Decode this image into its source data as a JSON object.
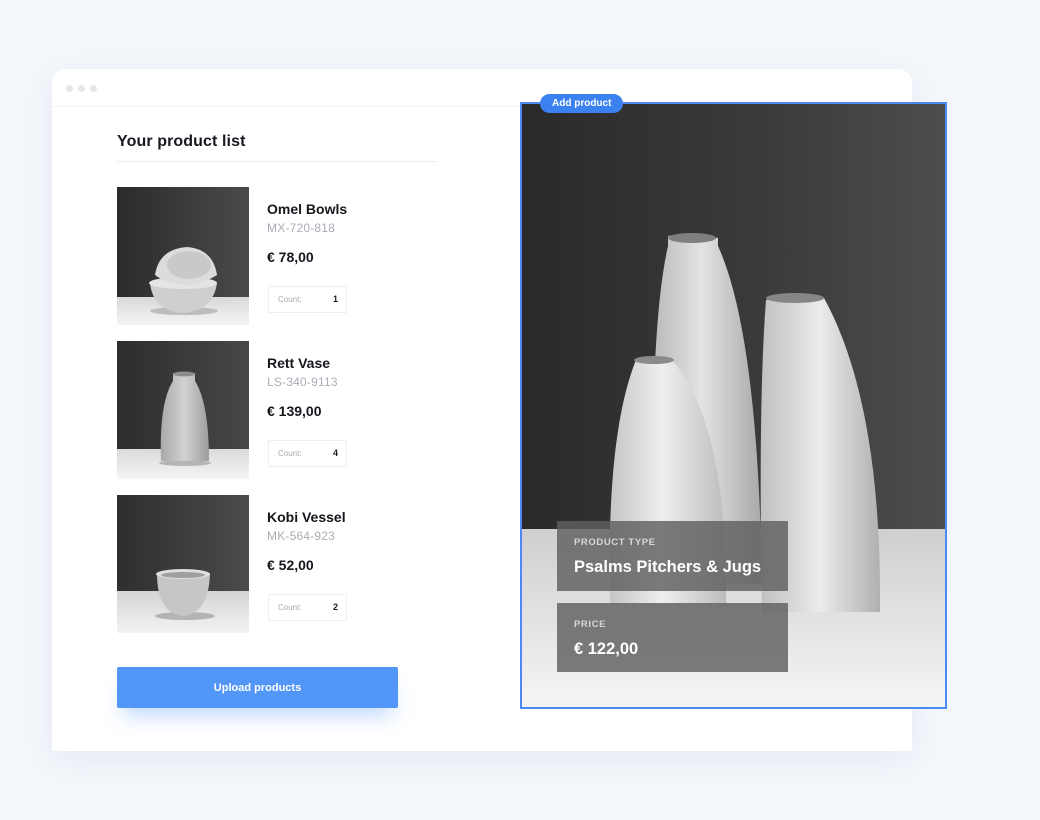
{
  "window": {
    "title_dots": [
      "close",
      "minimize",
      "maximize"
    ]
  },
  "list": {
    "title": "Your product list",
    "products": [
      {
        "name": "Omel Bowls",
        "sku": "MX-720-818",
        "price": "€ 78,00",
        "count_label": "Count:",
        "count": "1"
      },
      {
        "name": "Rett Vase",
        "sku": "LS-340-9113",
        "price": "€ 139,00",
        "count_label": "Count:",
        "count": "4"
      },
      {
        "name": "Kobi Vessel",
        "sku": "MK-564-923",
        "price": "€ 52,00",
        "count_label": "Count:",
        "count": "2"
      }
    ],
    "upload_label": "Upload products"
  },
  "preview": {
    "badge": "Add product",
    "type_label": "PRODUCT TYPE",
    "type_value": "Psalms Pitchers & Jugs",
    "price_label": "PRICE",
    "price_value": "€ 122,00"
  },
  "colors": {
    "accent": "#5296f7",
    "badge": "#3b82f0",
    "selection_border": "#4a8af2"
  },
  "icons": [
    "window-dot-icon"
  ]
}
